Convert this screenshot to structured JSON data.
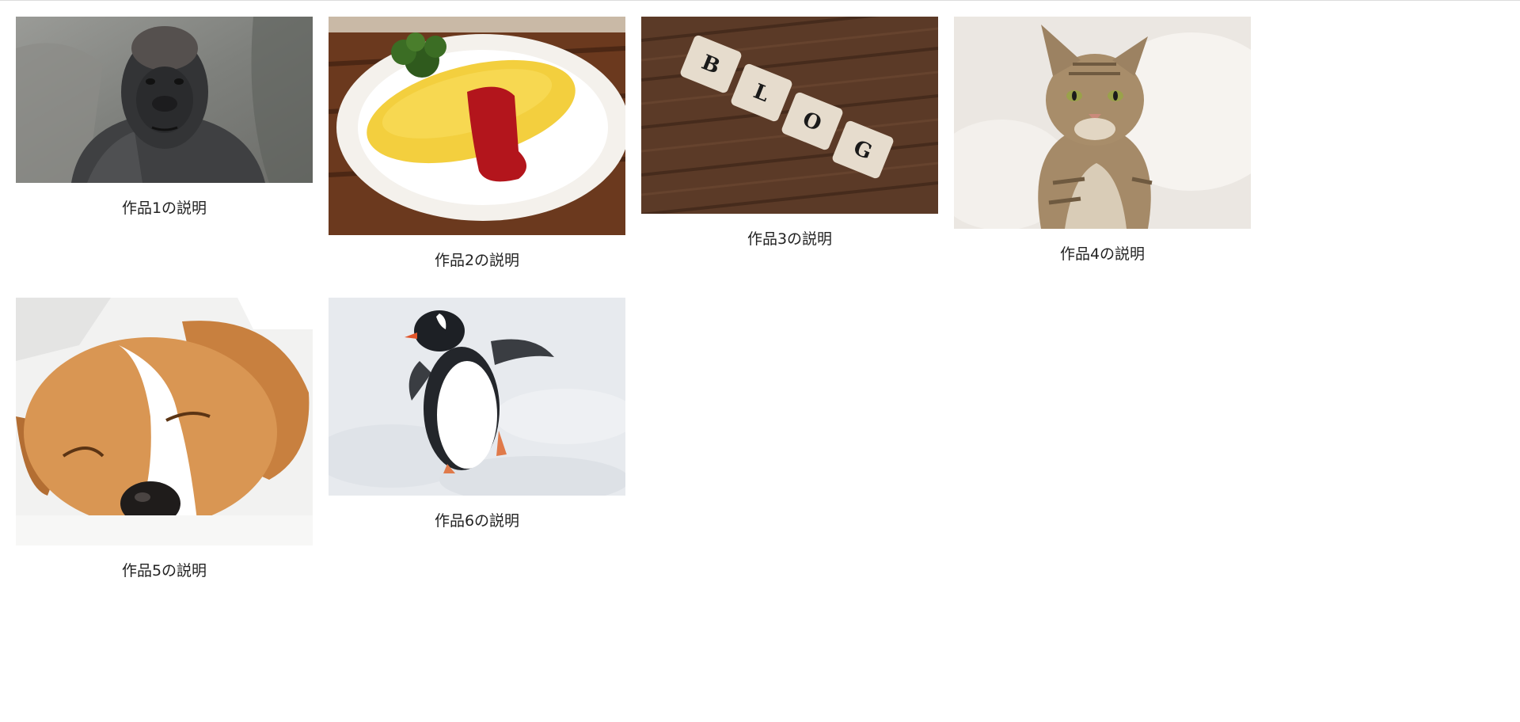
{
  "gallery": {
    "items": [
      {
        "caption": "作品1の説明",
        "subject": "gorilla"
      },
      {
        "caption": "作品2の説明",
        "subject": "omelette rice"
      },
      {
        "caption": "作品3の説明",
        "subject": "BLOG letter tiles on wood"
      },
      {
        "caption": "作品4の説明",
        "subject": "tabby cat"
      },
      {
        "caption": "作品5の説明",
        "subject": "sleeping beagle puppy"
      },
      {
        "caption": "作品6の説明",
        "subject": "penguin on snow"
      }
    ],
    "tile_letters": [
      "B",
      "L",
      "O",
      "G"
    ]
  },
  "colors": {
    "page_background": "#ffffff",
    "caption_text": "#222222",
    "top_rule": "#dcdcdc"
  }
}
